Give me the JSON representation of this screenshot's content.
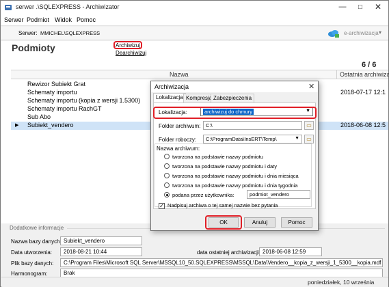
{
  "window": {
    "title": "serwer .\\SQLEXPRESS - Archiwizator",
    "minimize_icon": "minimize-icon",
    "maximize_icon": "maximize-icon",
    "close_icon": "close-icon"
  },
  "menu": [
    "Serwer",
    "Podmiot",
    "Widok",
    "Pomoc"
  ],
  "toolbar": {
    "server_label": "Serwer:",
    "server_name": "MMICHEL\\SQLEXPRESS",
    "e_archive_label": "e-archiwizacja"
  },
  "page": {
    "title": "Podmioty",
    "archive_link": "Archiwizuj",
    "dearchive_link": "Dearchiwizuj",
    "count": "6 / 6"
  },
  "grid": {
    "columns": {
      "name": "Nazwa",
      "last_archive": "Ostatnia archiwiza"
    },
    "rows": [
      {
        "name": "Rewizor Subiekt Grat",
        "date": ""
      },
      {
        "name": "Schematy importu",
        "date": "2018-07-17 12:1"
      },
      {
        "name": "Schematy importu (kopia z wersji 1.5300)",
        "date": ""
      },
      {
        "name": "Schematy importu RachGT",
        "date": ""
      },
      {
        "name": "Sub Abo",
        "date": ""
      },
      {
        "name": "Subiekt_vendero",
        "date": "2018-06-08 12:5"
      }
    ]
  },
  "details": {
    "title": "Dodatkowe informacje",
    "db_name_label": "Nazwa bazy danych:",
    "db_name": "Subiekt_vendero",
    "created_label": "Data utworzenia:",
    "created": "2018-08-21 10:44",
    "last_archive_label": "data ostatniej archiwizacji:",
    "last_archive": "2018-06-08 12:59",
    "db_file_label": "Plik bazy danych:",
    "db_file": "C:\\Program Files\\Microsoft SQL Server\\MSSQL10_50.SQLEXPRESS\\MSSQL\\Data\\Vendero__kopia_z_wersji_1_5300__kopia.mdf",
    "schedule_label": "Harmonogram:",
    "schedule": "Brak"
  },
  "status": {
    "date": "poniedziałek, 10 września 2018"
  },
  "dialog": {
    "title": "Archiwizacja",
    "tabs": [
      "Lokalizacja",
      "Kompresja",
      "Zabezpieczenia"
    ],
    "location_label": "Lokalizacja:",
    "location_value": "archiwizuj do chmury",
    "archive_folder_label": "Folder archiwum:",
    "archive_folder_value": "C:\\",
    "work_folder_label": "Folder roboczy:",
    "work_folder_value": "C:\\ProgramData\\InsERT\\Temp\\",
    "archive_name_label": "Nazwa archiwum:",
    "options": [
      "tworzona na podstawie nazwy podmiotu",
      "tworzona na podstawie nazwy podmiotu i daty",
      "tworzona na podstawie nazwy podmiotu i dnia miesiąca",
      "tworzona na podstawie nazwy podmiotu i dnia tygodnia",
      "podana przez użytkownika:"
    ],
    "selected_option": 4,
    "user_name_value": "podmiot_vendero",
    "overwrite_label": "Nadpisuj archiwa o tej samej nazwie bez pytania",
    "overwrite_checked": true,
    "ok": "OK",
    "cancel": "Anuluj",
    "help": "Pomoc"
  },
  "colors": {
    "highlight_red": "#e01e26",
    "selection_blue": "#0a64c8",
    "row_selected": "#cfe3f7"
  }
}
